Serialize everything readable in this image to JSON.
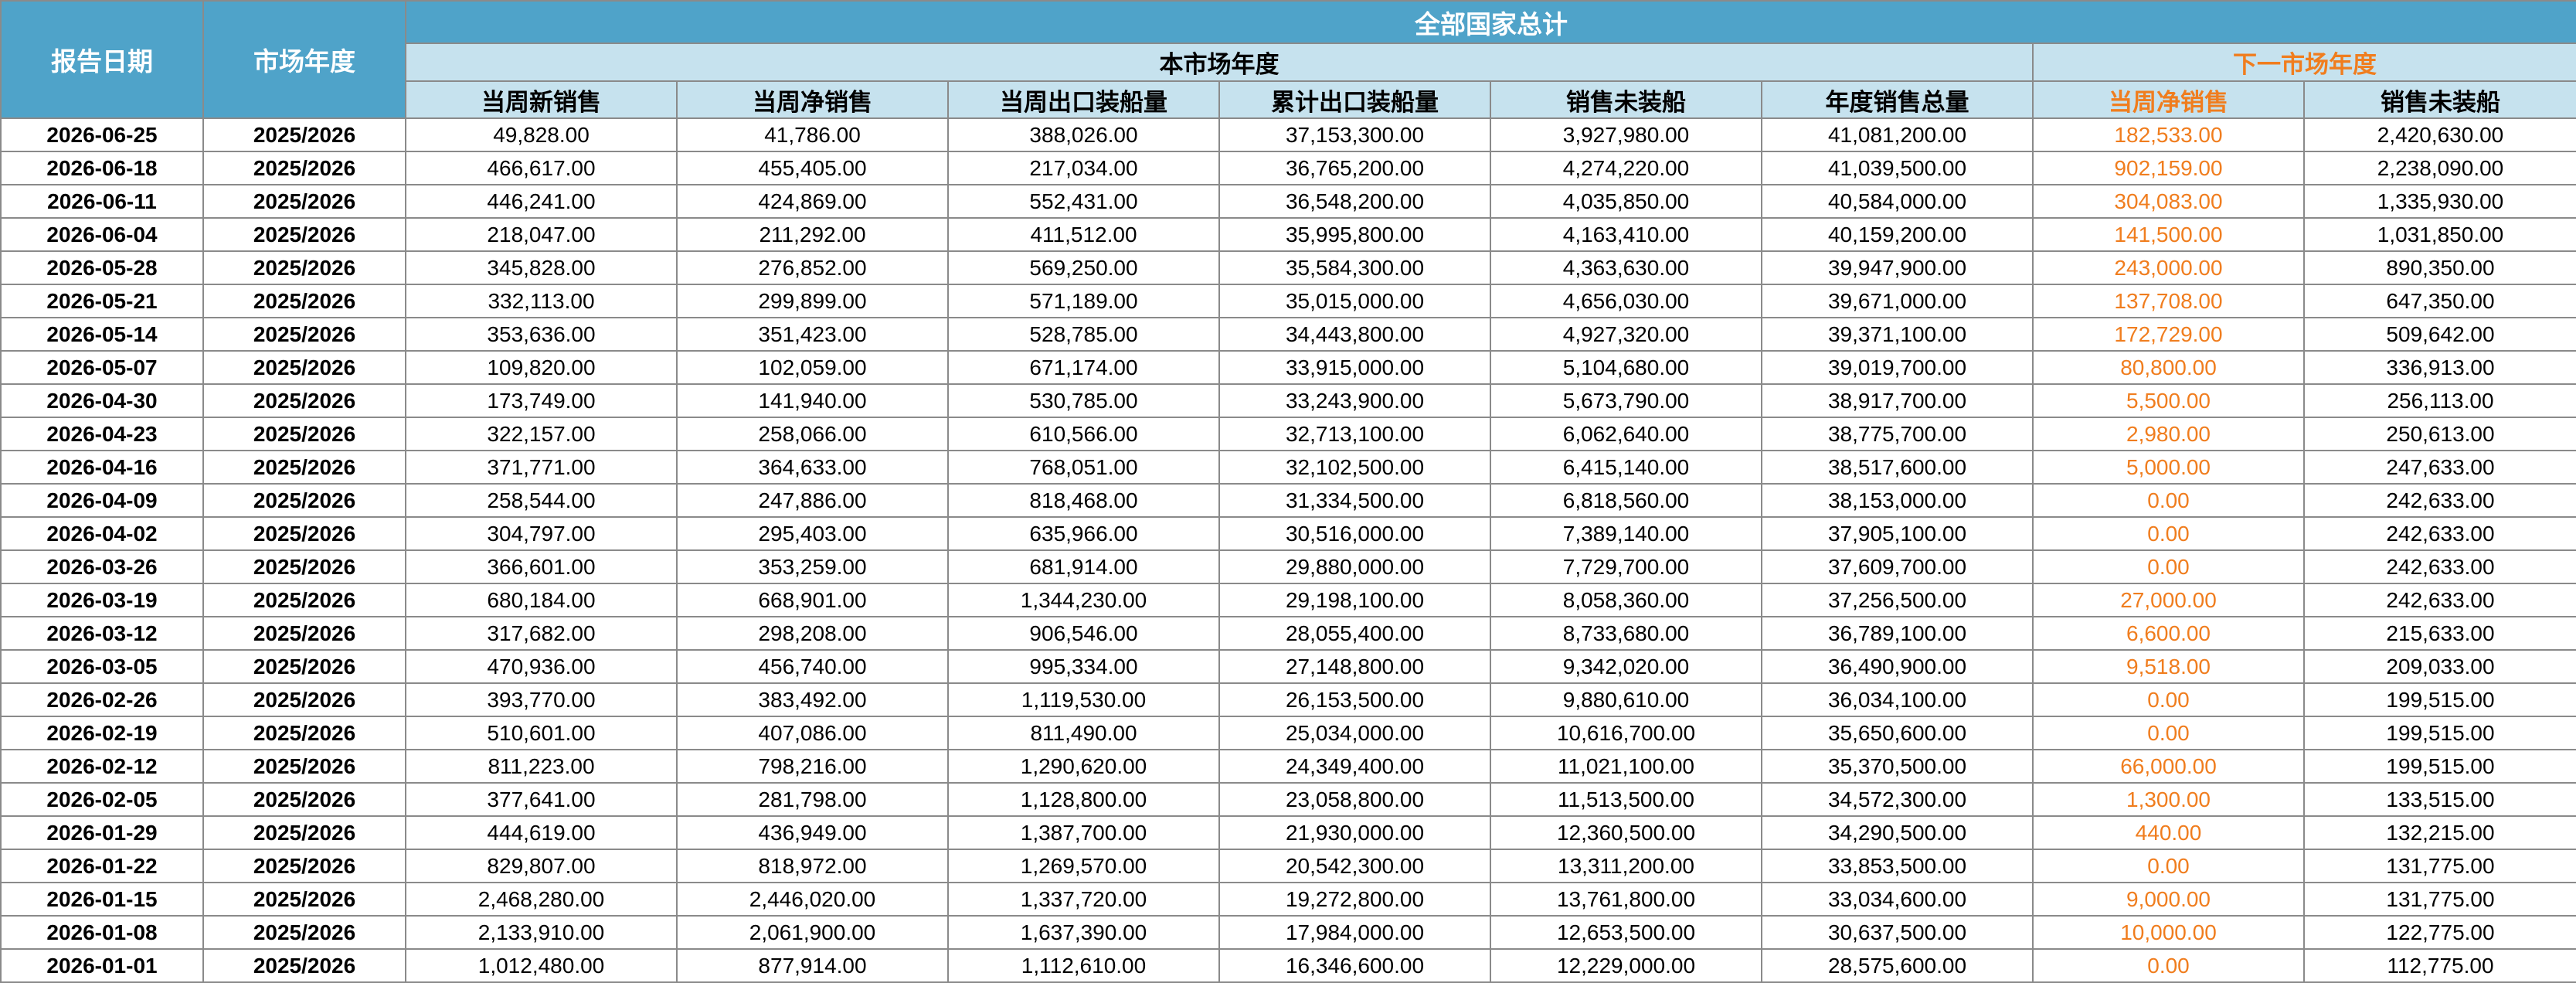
{
  "header": {
    "date_label": "报告日期",
    "year_label": "市场年度",
    "group_all": "全部国家总计",
    "group_current": "本市场年度",
    "group_next": "下一市场年度",
    "columns": [
      "当周新销售",
      "当周净销售",
      "当周出口装船量",
      "累计出口装船量",
      "销售未装船",
      "年度销售总量",
      "当周净销售",
      "销售未装船"
    ]
  },
  "colors": {
    "header_blue": "#4fa3c9",
    "subheader_light_blue": "#c6e2ee",
    "next_year_orange": "#f07d1e"
  },
  "rows": [
    [
      "2026-06-25",
      "2025/2026",
      "49,828.00",
      "41,786.00",
      "388,026.00",
      "37,153,300.00",
      "3,927,980.00",
      "41,081,200.00",
      "182,533.00",
      "2,420,630.00"
    ],
    [
      "2026-06-18",
      "2025/2026",
      "466,617.00",
      "455,405.00",
      "217,034.00",
      "36,765,200.00",
      "4,274,220.00",
      "41,039,500.00",
      "902,159.00",
      "2,238,090.00"
    ],
    [
      "2026-06-11",
      "2025/2026",
      "446,241.00",
      "424,869.00",
      "552,431.00",
      "36,548,200.00",
      "4,035,850.00",
      "40,584,000.00",
      "304,083.00",
      "1,335,930.00"
    ],
    [
      "2026-06-04",
      "2025/2026",
      "218,047.00",
      "211,292.00",
      "411,512.00",
      "35,995,800.00",
      "4,163,410.00",
      "40,159,200.00",
      "141,500.00",
      "1,031,850.00"
    ],
    [
      "2026-05-28",
      "2025/2026",
      "345,828.00",
      "276,852.00",
      "569,250.00",
      "35,584,300.00",
      "4,363,630.00",
      "39,947,900.00",
      "243,000.00",
      "890,350.00"
    ],
    [
      "2026-05-21",
      "2025/2026",
      "332,113.00",
      "299,899.00",
      "571,189.00",
      "35,015,000.00",
      "4,656,030.00",
      "39,671,000.00",
      "137,708.00",
      "647,350.00"
    ],
    [
      "2026-05-14",
      "2025/2026",
      "353,636.00",
      "351,423.00",
      "528,785.00",
      "34,443,800.00",
      "4,927,320.00",
      "39,371,100.00",
      "172,729.00",
      "509,642.00"
    ],
    [
      "2026-05-07",
      "2025/2026",
      "109,820.00",
      "102,059.00",
      "671,174.00",
      "33,915,000.00",
      "5,104,680.00",
      "39,019,700.00",
      "80,800.00",
      "336,913.00"
    ],
    [
      "2026-04-30",
      "2025/2026",
      "173,749.00",
      "141,940.00",
      "530,785.00",
      "33,243,900.00",
      "5,673,790.00",
      "38,917,700.00",
      "5,500.00",
      "256,113.00"
    ],
    [
      "2026-04-23",
      "2025/2026",
      "322,157.00",
      "258,066.00",
      "610,566.00",
      "32,713,100.00",
      "6,062,640.00",
      "38,775,700.00",
      "2,980.00",
      "250,613.00"
    ],
    [
      "2026-04-16",
      "2025/2026",
      "371,771.00",
      "364,633.00",
      "768,051.00",
      "32,102,500.00",
      "6,415,140.00",
      "38,517,600.00",
      "5,000.00",
      "247,633.00"
    ],
    [
      "2026-04-09",
      "2025/2026",
      "258,544.00",
      "247,886.00",
      "818,468.00",
      "31,334,500.00",
      "6,818,560.00",
      "38,153,000.00",
      "0.00",
      "242,633.00"
    ],
    [
      "2026-04-02",
      "2025/2026",
      "304,797.00",
      "295,403.00",
      "635,966.00",
      "30,516,000.00",
      "7,389,140.00",
      "37,905,100.00",
      "0.00",
      "242,633.00"
    ],
    [
      "2026-03-26",
      "2025/2026",
      "366,601.00",
      "353,259.00",
      "681,914.00",
      "29,880,000.00",
      "7,729,700.00",
      "37,609,700.00",
      "0.00",
      "242,633.00"
    ],
    [
      "2026-03-19",
      "2025/2026",
      "680,184.00",
      "668,901.00",
      "1,344,230.00",
      "29,198,100.00",
      "8,058,360.00",
      "37,256,500.00",
      "27,000.00",
      "242,633.00"
    ],
    [
      "2026-03-12",
      "2025/2026",
      "317,682.00",
      "298,208.00",
      "906,546.00",
      "28,055,400.00",
      "8,733,680.00",
      "36,789,100.00",
      "6,600.00",
      "215,633.00"
    ],
    [
      "2026-03-05",
      "2025/2026",
      "470,936.00",
      "456,740.00",
      "995,334.00",
      "27,148,800.00",
      "9,342,020.00",
      "36,490,900.00",
      "9,518.00",
      "209,033.00"
    ],
    [
      "2026-02-26",
      "2025/2026",
      "393,770.00",
      "383,492.00",
      "1,119,530.00",
      "26,153,500.00",
      "9,880,610.00",
      "36,034,100.00",
      "0.00",
      "199,515.00"
    ],
    [
      "2026-02-19",
      "2025/2026",
      "510,601.00",
      "407,086.00",
      "811,490.00",
      "25,034,000.00",
      "10,616,700.00",
      "35,650,600.00",
      "0.00",
      "199,515.00"
    ],
    [
      "2026-02-12",
      "2025/2026",
      "811,223.00",
      "798,216.00",
      "1,290,620.00",
      "24,349,400.00",
      "11,021,100.00",
      "35,370,500.00",
      "66,000.00",
      "199,515.00"
    ],
    [
      "2026-02-05",
      "2025/2026",
      "377,641.00",
      "281,798.00",
      "1,128,800.00",
      "23,058,800.00",
      "11,513,500.00",
      "34,572,300.00",
      "1,300.00",
      "133,515.00"
    ],
    [
      "2026-01-29",
      "2025/2026",
      "444,619.00",
      "436,949.00",
      "1,387,700.00",
      "21,930,000.00",
      "12,360,500.00",
      "34,290,500.00",
      "440.00",
      "132,215.00"
    ],
    [
      "2026-01-22",
      "2025/2026",
      "829,807.00",
      "818,972.00",
      "1,269,570.00",
      "20,542,300.00",
      "13,311,200.00",
      "33,853,500.00",
      "0.00",
      "131,775.00"
    ],
    [
      "2026-01-15",
      "2025/2026",
      "2,468,280.00",
      "2,446,020.00",
      "1,337,720.00",
      "19,272,800.00",
      "13,761,800.00",
      "33,034,600.00",
      "9,000.00",
      "131,775.00"
    ],
    [
      "2026-01-08",
      "2025/2026",
      "2,133,910.00",
      "2,061,900.00",
      "1,637,390.00",
      "17,984,000.00",
      "12,653,500.00",
      "30,637,500.00",
      "10,000.00",
      "122,775.00"
    ],
    [
      "2026-01-01",
      "2025/2026",
      "1,012,480.00",
      "877,914.00",
      "1,112,610.00",
      "16,346,600.00",
      "12,229,000.00",
      "28,575,600.00",
      "0.00",
      "112,775.00"
    ]
  ]
}
